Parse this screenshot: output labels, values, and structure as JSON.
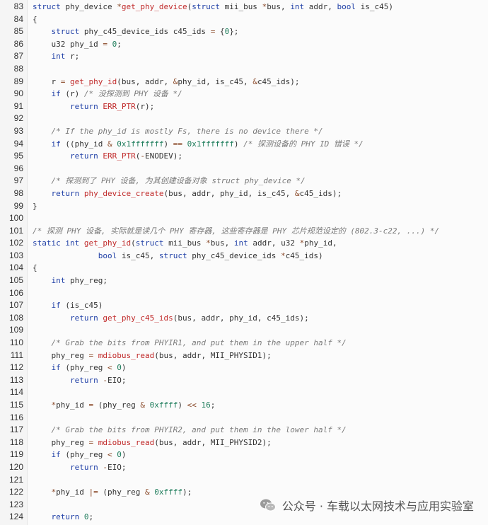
{
  "code": {
    "lines": [
      {
        "num": "83",
        "tokens": [
          [
            "k",
            "struct"
          ],
          [
            "t",
            " phy_device "
          ],
          [
            "o",
            "*"
          ],
          [
            "f",
            "get_phy_device"
          ],
          [
            "t",
            "("
          ],
          [
            "k",
            "struct"
          ],
          [
            "t",
            " mii_bus "
          ],
          [
            "o",
            "*"
          ],
          [
            "t",
            "bus, "
          ],
          [
            "k",
            "int"
          ],
          [
            "t",
            " addr, "
          ],
          [
            "k",
            "bool"
          ],
          [
            "t",
            " is_c45)"
          ]
        ]
      },
      {
        "num": "84",
        "tokens": [
          [
            "t",
            "{"
          ]
        ]
      },
      {
        "num": "85",
        "tokens": [
          [
            "t",
            "    "
          ],
          [
            "k",
            "struct"
          ],
          [
            "t",
            " phy_c45_device_ids c45_ids "
          ],
          [
            "o",
            "="
          ],
          [
            "t",
            " {"
          ],
          [
            "n",
            "0"
          ],
          [
            "t",
            "};"
          ]
        ]
      },
      {
        "num": "86",
        "tokens": [
          [
            "t",
            "    u32 phy_id "
          ],
          [
            "o",
            "="
          ],
          [
            "t",
            " "
          ],
          [
            "n",
            "0"
          ],
          [
            "t",
            ";"
          ]
        ]
      },
      {
        "num": "87",
        "tokens": [
          [
            "t",
            "    "
          ],
          [
            "k",
            "int"
          ],
          [
            "t",
            " r;"
          ]
        ]
      },
      {
        "num": "88",
        "tokens": []
      },
      {
        "num": "89",
        "tokens": [
          [
            "t",
            "    r "
          ],
          [
            "o",
            "="
          ],
          [
            "t",
            " "
          ],
          [
            "f",
            "get_phy_id"
          ],
          [
            "t",
            "(bus, addr, "
          ],
          [
            "o",
            "&"
          ],
          [
            "t",
            "phy_id, is_c45, "
          ],
          [
            "o",
            "&"
          ],
          [
            "t",
            "c45_ids);"
          ]
        ]
      },
      {
        "num": "90",
        "tokens": [
          [
            "t",
            "    "
          ],
          [
            "k",
            "if"
          ],
          [
            "t",
            " (r) "
          ],
          [
            "c",
            "/* 没探测到 PHY 设备 */"
          ]
        ]
      },
      {
        "num": "91",
        "tokens": [
          [
            "t",
            "        "
          ],
          [
            "k",
            "return"
          ],
          [
            "t",
            " "
          ],
          [
            "f",
            "ERR_PTR"
          ],
          [
            "t",
            "(r);"
          ]
        ]
      },
      {
        "num": "92",
        "tokens": []
      },
      {
        "num": "93",
        "tokens": [
          [
            "t",
            "    "
          ],
          [
            "c",
            "/* If the phy_id is mostly Fs, there is no device there */"
          ]
        ]
      },
      {
        "num": "94",
        "tokens": [
          [
            "t",
            "    "
          ],
          [
            "k",
            "if"
          ],
          [
            "t",
            " ((phy_id "
          ],
          [
            "o",
            "&"
          ],
          [
            "t",
            " "
          ],
          [
            "n",
            "0x1fffffff"
          ],
          [
            "t",
            ") "
          ],
          [
            "o",
            "=="
          ],
          [
            "t",
            " "
          ],
          [
            "n",
            "0x1fffffff"
          ],
          [
            "t",
            ") "
          ],
          [
            "c",
            "/* 探测设备的 PHY ID 错误 */"
          ]
        ]
      },
      {
        "num": "95",
        "tokens": [
          [
            "t",
            "        "
          ],
          [
            "k",
            "return"
          ],
          [
            "t",
            " "
          ],
          [
            "f",
            "ERR_PTR"
          ],
          [
            "t",
            "("
          ],
          [
            "o",
            "-"
          ],
          [
            "t",
            "ENODEV);"
          ]
        ]
      },
      {
        "num": "96",
        "tokens": []
      },
      {
        "num": "97",
        "tokens": [
          [
            "t",
            "    "
          ],
          [
            "c",
            "/* 探测到了 PHY 设备, 为其创建设备对象 struct phy_device */"
          ]
        ]
      },
      {
        "num": "98",
        "tokens": [
          [
            "t",
            "    "
          ],
          [
            "k",
            "return"
          ],
          [
            "t",
            " "
          ],
          [
            "f",
            "phy_device_create"
          ],
          [
            "t",
            "(bus, addr, phy_id, is_c45, "
          ],
          [
            "o",
            "&"
          ],
          [
            "t",
            "c45_ids);"
          ]
        ]
      },
      {
        "num": "99",
        "tokens": [
          [
            "t",
            "}"
          ]
        ]
      },
      {
        "num": "100",
        "tokens": []
      },
      {
        "num": "101",
        "tokens": [
          [
            "c",
            "/* 探测 PHY 设备, 实际就是读几个 PHY 寄存器, 这些寄存器是 PHY 芯片规范设定的 (802.3-c22, ...) */"
          ]
        ]
      },
      {
        "num": "102",
        "tokens": [
          [
            "k",
            "static"
          ],
          [
            "t",
            " "
          ],
          [
            "k",
            "int"
          ],
          [
            "t",
            " "
          ],
          [
            "f",
            "get_phy_id"
          ],
          [
            "t",
            "("
          ],
          [
            "k",
            "struct"
          ],
          [
            "t",
            " mii_bus "
          ],
          [
            "o",
            "*"
          ],
          [
            "t",
            "bus, "
          ],
          [
            "k",
            "int"
          ],
          [
            "t",
            " addr, u32 "
          ],
          [
            "o",
            "*"
          ],
          [
            "t",
            "phy_id,"
          ]
        ]
      },
      {
        "num": "103",
        "tokens": [
          [
            "t",
            "              "
          ],
          [
            "k",
            "bool"
          ],
          [
            "t",
            " is_c45, "
          ],
          [
            "k",
            "struct"
          ],
          [
            "t",
            " phy_c45_device_ids "
          ],
          [
            "o",
            "*"
          ],
          [
            "t",
            "c45_ids)"
          ]
        ]
      },
      {
        "num": "104",
        "tokens": [
          [
            "t",
            "{"
          ]
        ]
      },
      {
        "num": "105",
        "tokens": [
          [
            "t",
            "    "
          ],
          [
            "k",
            "int"
          ],
          [
            "t",
            " phy_reg;"
          ]
        ]
      },
      {
        "num": "106",
        "tokens": []
      },
      {
        "num": "107",
        "tokens": [
          [
            "t",
            "    "
          ],
          [
            "k",
            "if"
          ],
          [
            "t",
            " (is_c45)"
          ]
        ]
      },
      {
        "num": "108",
        "tokens": [
          [
            "t",
            "        "
          ],
          [
            "k",
            "return"
          ],
          [
            "t",
            " "
          ],
          [
            "f",
            "get_phy_c45_ids"
          ],
          [
            "t",
            "(bus, addr, phy_id, c45_ids);"
          ]
        ]
      },
      {
        "num": "109",
        "tokens": []
      },
      {
        "num": "110",
        "tokens": [
          [
            "t",
            "    "
          ],
          [
            "c",
            "/* Grab the bits from PHYIR1, and put them in the upper half */"
          ]
        ]
      },
      {
        "num": "111",
        "tokens": [
          [
            "t",
            "    phy_reg "
          ],
          [
            "o",
            "="
          ],
          [
            "t",
            " "
          ],
          [
            "f",
            "mdiobus_read"
          ],
          [
            "t",
            "(bus, addr, MII_PHYSID1);"
          ]
        ]
      },
      {
        "num": "112",
        "tokens": [
          [
            "t",
            "    "
          ],
          [
            "k",
            "if"
          ],
          [
            "t",
            " (phy_reg "
          ],
          [
            "o",
            "<"
          ],
          [
            "t",
            " "
          ],
          [
            "n",
            "0"
          ],
          [
            "t",
            ")"
          ]
        ]
      },
      {
        "num": "113",
        "tokens": [
          [
            "t",
            "        "
          ],
          [
            "k",
            "return"
          ],
          [
            "t",
            " "
          ],
          [
            "o",
            "-"
          ],
          [
            "t",
            "EIO;"
          ]
        ]
      },
      {
        "num": "114",
        "tokens": []
      },
      {
        "num": "115",
        "tokens": [
          [
            "t",
            "    "
          ],
          [
            "o",
            "*"
          ],
          [
            "t",
            "phy_id "
          ],
          [
            "o",
            "="
          ],
          [
            "t",
            " (phy_reg "
          ],
          [
            "o",
            "&"
          ],
          [
            "t",
            " "
          ],
          [
            "n",
            "0xffff"
          ],
          [
            "t",
            ") "
          ],
          [
            "o",
            "<<"
          ],
          [
            "t",
            " "
          ],
          [
            "n",
            "16"
          ],
          [
            "t",
            ";"
          ]
        ]
      },
      {
        "num": "116",
        "tokens": []
      },
      {
        "num": "117",
        "tokens": [
          [
            "t",
            "    "
          ],
          [
            "c",
            "/* Grab the bits from PHYIR2, and put them in the lower half */"
          ]
        ]
      },
      {
        "num": "118",
        "tokens": [
          [
            "t",
            "    phy_reg "
          ],
          [
            "o",
            "="
          ],
          [
            "t",
            " "
          ],
          [
            "f",
            "mdiobus_read"
          ],
          [
            "t",
            "(bus, addr, MII_PHYSID2);"
          ]
        ]
      },
      {
        "num": "119",
        "tokens": [
          [
            "t",
            "    "
          ],
          [
            "k",
            "if"
          ],
          [
            "t",
            " (phy_reg "
          ],
          [
            "o",
            "<"
          ],
          [
            "t",
            " "
          ],
          [
            "n",
            "0"
          ],
          [
            "t",
            ")"
          ]
        ]
      },
      {
        "num": "120",
        "tokens": [
          [
            "t",
            "        "
          ],
          [
            "k",
            "return"
          ],
          [
            "t",
            " "
          ],
          [
            "o",
            "-"
          ],
          [
            "t",
            "EIO;"
          ]
        ]
      },
      {
        "num": "121",
        "tokens": []
      },
      {
        "num": "122",
        "tokens": [
          [
            "t",
            "    "
          ],
          [
            "o",
            "*"
          ],
          [
            "t",
            "phy_id "
          ],
          [
            "o",
            "|="
          ],
          [
            "t",
            " (phy_reg "
          ],
          [
            "o",
            "&"
          ],
          [
            "t",
            " "
          ],
          [
            "n",
            "0xffff"
          ],
          [
            "t",
            ");"
          ]
        ]
      },
      {
        "num": "123",
        "tokens": []
      },
      {
        "num": "124",
        "tokens": [
          [
            "t",
            "    "
          ],
          [
            "k",
            "return"
          ],
          [
            "t",
            " "
          ],
          [
            "n",
            "0"
          ],
          [
            "t",
            ";"
          ]
        ]
      }
    ]
  },
  "watermark": {
    "text": "公众号 · 车载以太网技术与应用实验室",
    "icon": "wechat-icon"
  }
}
